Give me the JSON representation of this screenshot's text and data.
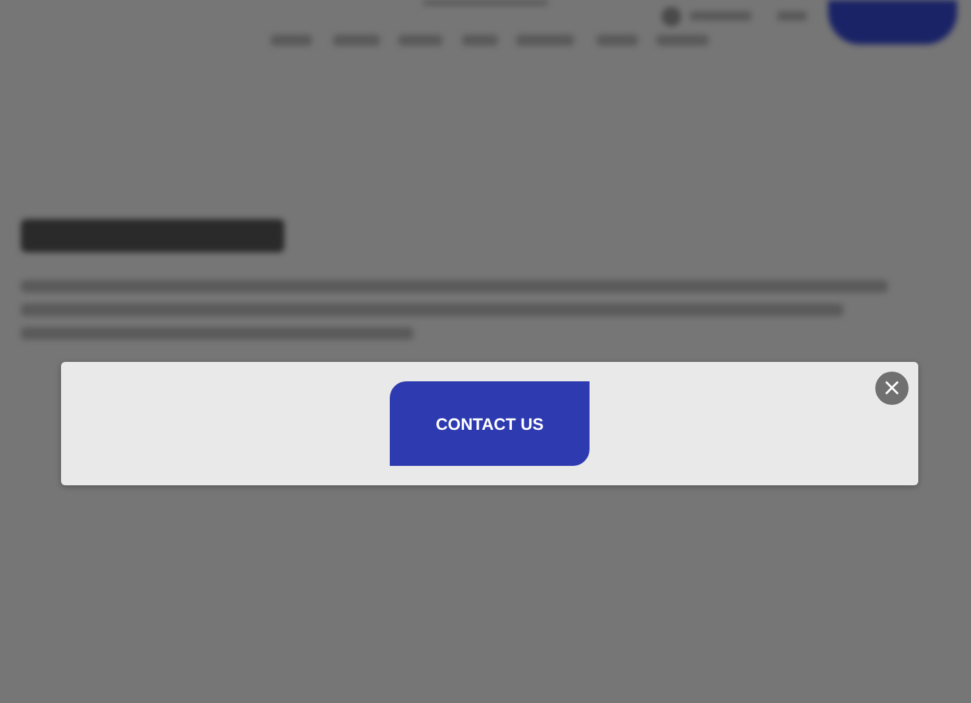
{
  "modal": {
    "button": "CONTACT US",
    "close": "×"
  }
}
